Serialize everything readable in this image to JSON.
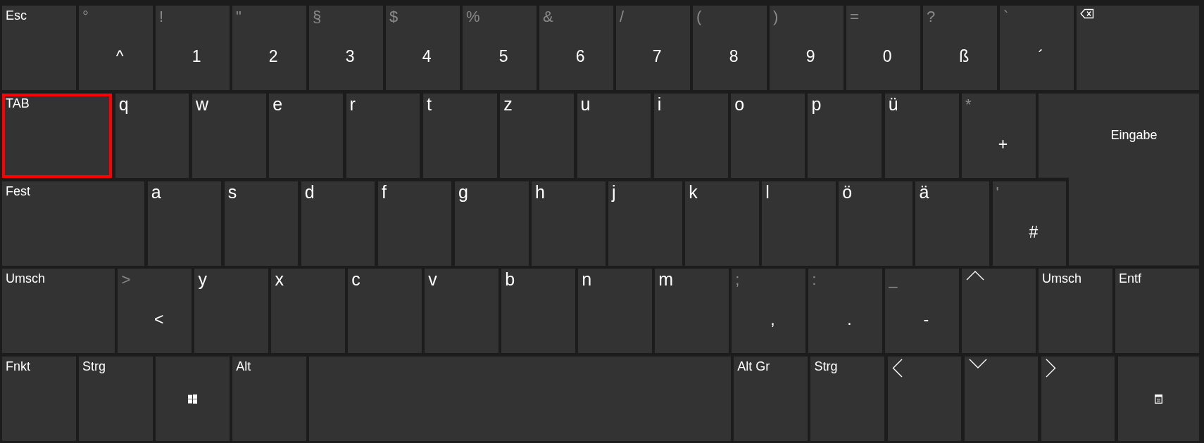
{
  "keyboard": {
    "rows": [
      {
        "keys": [
          {
            "kind": "label",
            "label": "Esc",
            "selected": false
          },
          {
            "kind": "symbol",
            "shift": "°",
            "label": "^",
            "selected": false
          },
          {
            "kind": "symbol",
            "shift": "!",
            "label": "1",
            "selected": false
          },
          {
            "kind": "symbol",
            "shift": "\"",
            "label": "2",
            "selected": false
          },
          {
            "kind": "symbol",
            "shift": "§",
            "label": "3",
            "selected": false
          },
          {
            "kind": "symbol",
            "shift": "$",
            "label": "4",
            "selected": false
          },
          {
            "kind": "symbol",
            "shift": "%",
            "label": "5",
            "selected": false
          },
          {
            "kind": "symbol",
            "shift": "&",
            "label": "6",
            "selected": false
          },
          {
            "kind": "symbol",
            "shift": "/",
            "label": "7",
            "selected": false
          },
          {
            "kind": "symbol",
            "shift": "(",
            "label": "8",
            "selected": false
          },
          {
            "kind": "symbol",
            "shift": ")",
            "label": "9",
            "selected": false
          },
          {
            "kind": "symbol",
            "shift": "=",
            "label": "0",
            "selected": false
          },
          {
            "kind": "symbol",
            "shift": "?",
            "label": "ß",
            "selected": false
          },
          {
            "kind": "symbol",
            "shift": "`",
            "label": "´",
            "selected": false
          },
          {
            "kind": "backspace",
            "selected": false
          }
        ]
      },
      {
        "keys": [
          {
            "kind": "label",
            "label": "TAB",
            "selected": true
          },
          {
            "kind": "letter",
            "label": "q",
            "selected": false
          },
          {
            "kind": "letter",
            "label": "w",
            "selected": false
          },
          {
            "kind": "letter",
            "label": "e",
            "selected": false
          },
          {
            "kind": "letter",
            "label": "r",
            "selected": false
          },
          {
            "kind": "letter",
            "label": "t",
            "selected": false
          },
          {
            "kind": "letter",
            "label": "z",
            "selected": false
          },
          {
            "kind": "letter",
            "label": "u",
            "selected": false
          },
          {
            "kind": "letter",
            "label": "i",
            "selected": false
          },
          {
            "kind": "letter",
            "label": "o",
            "selected": false
          },
          {
            "kind": "letter",
            "label": "p",
            "selected": false
          },
          {
            "kind": "letter",
            "label": "ü",
            "selected": false
          },
          {
            "kind": "symbol",
            "shift": "*",
            "label": "+",
            "selected": false
          },
          {
            "kind": "enter",
            "label": "Eingabe",
            "selected": false
          }
        ]
      },
      {
        "keys": [
          {
            "kind": "label",
            "label": "Fest",
            "selected": false
          },
          {
            "kind": "letter",
            "label": "a",
            "selected": false
          },
          {
            "kind": "letter",
            "label": "s",
            "selected": false
          },
          {
            "kind": "letter",
            "label": "d",
            "selected": false
          },
          {
            "kind": "letter",
            "label": "f",
            "selected": false
          },
          {
            "kind": "letter",
            "label": "g",
            "selected": false
          },
          {
            "kind": "letter",
            "label": "h",
            "selected": false
          },
          {
            "kind": "letter",
            "label": "j",
            "selected": false
          },
          {
            "kind": "letter",
            "label": "k",
            "selected": false
          },
          {
            "kind": "letter",
            "label": "l",
            "selected": false
          },
          {
            "kind": "letter",
            "label": "ö",
            "selected": false
          },
          {
            "kind": "letter",
            "label": "ä",
            "selected": false
          },
          {
            "kind": "symbol",
            "shift": "'",
            "label": "#",
            "selected": false
          }
        ]
      },
      {
        "keys": [
          {
            "kind": "label",
            "label": "Umsch",
            "selected": false
          },
          {
            "kind": "symbol",
            "shift": ">",
            "label": "<",
            "selected": false
          },
          {
            "kind": "letter",
            "label": "y",
            "selected": false
          },
          {
            "kind": "letter",
            "label": "x",
            "selected": false
          },
          {
            "kind": "letter",
            "label": "c",
            "selected": false
          },
          {
            "kind": "letter",
            "label": "v",
            "selected": false
          },
          {
            "kind": "letter",
            "label": "b",
            "selected": false
          },
          {
            "kind": "letter",
            "label": "n",
            "selected": false
          },
          {
            "kind": "letter",
            "label": "m",
            "selected": false
          },
          {
            "kind": "symbol",
            "shift": ";",
            "label": ",",
            "selected": false
          },
          {
            "kind": "symbol",
            "shift": ":",
            "label": ".",
            "selected": false
          },
          {
            "kind": "symbol",
            "shift": "_",
            "label": "-",
            "selected": false
          },
          {
            "kind": "arrow-up",
            "selected": false
          },
          {
            "kind": "label",
            "label": "Umsch",
            "selected": false
          },
          {
            "kind": "label",
            "label": "Entf",
            "selected": false
          }
        ]
      },
      {
        "keys": [
          {
            "kind": "label",
            "label": "Fnkt",
            "selected": false
          },
          {
            "kind": "label",
            "label": "Strg",
            "selected": false
          },
          {
            "kind": "windows",
            "selected": false
          },
          {
            "kind": "label",
            "label": "Alt",
            "selected": false
          },
          {
            "kind": "space",
            "selected": false
          },
          {
            "kind": "label",
            "label": "Alt Gr",
            "selected": false
          },
          {
            "kind": "label",
            "label": "Strg",
            "selected": false
          },
          {
            "kind": "arrow-left",
            "selected": false
          },
          {
            "kind": "arrow-down",
            "selected": false
          },
          {
            "kind": "arrow-right",
            "selected": false
          },
          {
            "kind": "menu",
            "selected": false
          }
        ]
      }
    ]
  }
}
